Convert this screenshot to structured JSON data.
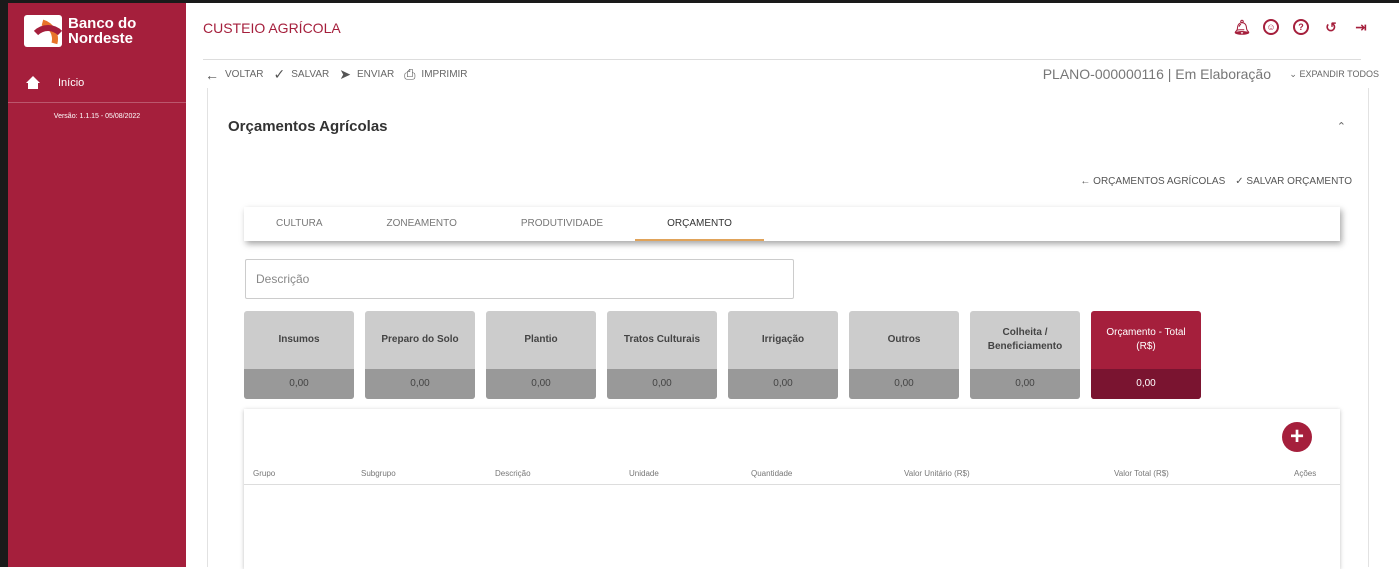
{
  "sidebar": {
    "logo_line1": "Banco do",
    "logo_line2": "Nordeste",
    "home_label": "Início",
    "version": "Versão: 1.1.15 - 05/08/2022"
  },
  "header": {
    "title": "CUSTEIO AGRÍCOLA",
    "icons": [
      "bell-icon",
      "user-icon",
      "help-icon",
      "history-icon",
      "logout-icon"
    ]
  },
  "toolbar": {
    "back_label": "VOLTAR",
    "save_label": "SALVAR",
    "send_label": "ENVIAR",
    "print_label": "IMPRIMIR",
    "plan_info": "PLANO-000000116 | Em Elaboração",
    "expand_label": "EXPANDIR TODOS"
  },
  "section": {
    "title": "Orçamentos Agrícolas",
    "back_to_label": "ORÇAMENTOS AGRÍCOLAS",
    "save_budget_label": "SALVAR ORÇAMENTO"
  },
  "tabs": [
    {
      "label": "CULTURA"
    },
    {
      "label": "ZONEAMENTO"
    },
    {
      "label": "PRODUTIVIDADE"
    },
    {
      "label": "ORÇAMENTO"
    }
  ],
  "description": {
    "placeholder": "Descrição"
  },
  "categories": [
    {
      "title": "Insumos",
      "value": "0,00"
    },
    {
      "title": "Preparo do Solo",
      "value": "0,00"
    },
    {
      "title": "Plantio",
      "value": "0,00"
    },
    {
      "title": "Tratos Culturais",
      "value": "0,00"
    },
    {
      "title": "Irrigação",
      "value": "0,00"
    },
    {
      "title": "Outros",
      "value": "0,00"
    },
    {
      "title": "Colheita / Beneficiamento",
      "value": "0,00"
    },
    {
      "title": "Orçamento - Total (R$)",
      "value": "0,00"
    }
  ],
  "table": {
    "columns": [
      "Grupo",
      "Subgrupo",
      "Descrição",
      "Unidade",
      "Quantidade",
      "Valor Unitário (R$)",
      "Valor Total (R$)",
      "Ações"
    ]
  },
  "colors": {
    "brand": "#a51f3c",
    "accent_tab": "#e0a35a"
  }
}
